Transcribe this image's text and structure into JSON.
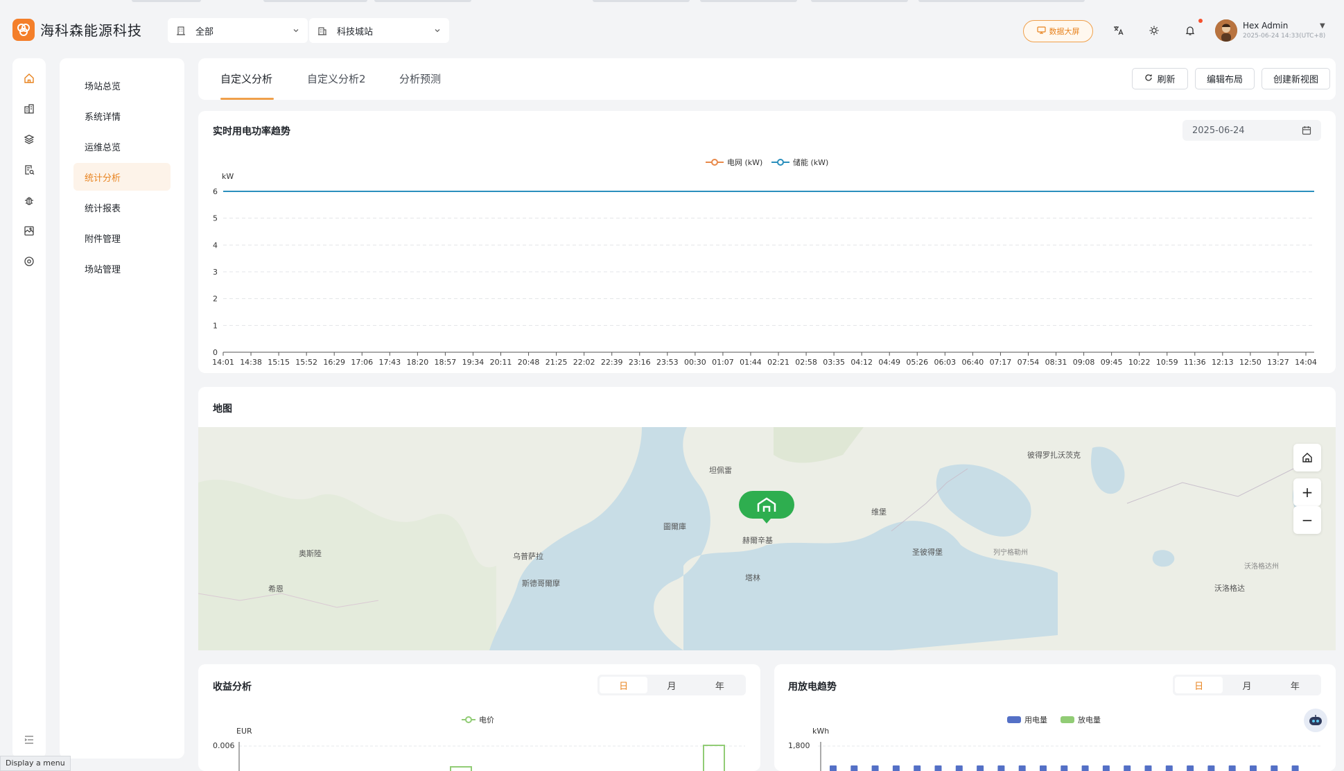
{
  "brand": {
    "name": "海科森能源科技"
  },
  "header": {
    "area_select": "全部",
    "station_select": "科技城站",
    "bigscreen_label": "数据大屏",
    "user": {
      "name": "Hex Admin",
      "datetime": "2025-06-24 14:33(UTC+8)"
    }
  },
  "subnav": {
    "items": [
      "场站总览",
      "系统详情",
      "运维总览",
      "统计分析",
      "统计报表",
      "附件管理",
      "场站管理"
    ],
    "active_index": 3
  },
  "tabs": {
    "items": [
      "自定义分析",
      "自定义分析2",
      "分析预测"
    ],
    "active_index": 0
  },
  "actions": {
    "refresh": "刷新",
    "edit_layout": "编辑布局",
    "create_view": "创建新视图"
  },
  "power_card": {
    "title": "实时用电功率趋势",
    "date": "2025-06-24"
  },
  "map_card": {
    "title": "地图",
    "labels": [
      "彼得罗扎沃茨克",
      "坦佩雷",
      "维堡",
      "圖爾庫",
      "赫爾辛基",
      "奥斯陸",
      "乌普萨拉",
      "圣彼得堡",
      "列宁格勒州",
      "沃洛格达州",
      "斯德哥爾摩",
      "塔林",
      "希恩",
      "沃洛格达"
    ]
  },
  "revenue_card": {
    "title": "收益分析",
    "periods": [
      "日",
      "月",
      "年"
    ],
    "active_period": 0
  },
  "energy_card": {
    "title": "用放电趋势",
    "periods": [
      "日",
      "月",
      "年"
    ],
    "active_period": 0
  },
  "tooltip": "Display a menu",
  "colors": {
    "accent": "#f0a04b",
    "grid_series": "#e8894a",
    "storage_series": "#2a8fbd",
    "charge": "#5470c6",
    "discharge": "#91cc75"
  },
  "chart_data": [
    {
      "type": "line",
      "ylabel": "kW",
      "ylim": [
        0,
        6
      ],
      "yticks": [
        0,
        1,
        2,
        3,
        4,
        5,
        6
      ],
      "x": [
        "14:01",
        "14:38",
        "15:15",
        "15:52",
        "16:29",
        "17:06",
        "17:43",
        "18:20",
        "18:57",
        "19:34",
        "20:11",
        "20:48",
        "21:25",
        "22:02",
        "22:39",
        "23:16",
        "23:53",
        "00:30",
        "01:07",
        "01:44",
        "02:21",
        "02:58",
        "03:35",
        "04:12",
        "04:49",
        "05:26",
        "06:03",
        "06:40",
        "07:17",
        "07:54",
        "08:31",
        "09:08",
        "09:45",
        "10:22",
        "10:59",
        "11:36",
        "12:13",
        "12:50",
        "13:27",
        "14:04"
      ],
      "series": [
        {
          "name": "电网 (kW)",
          "values": []
        },
        {
          "name": "储能 (kW)",
          "values": [
            6,
            6,
            6,
            6,
            6,
            6,
            6,
            6,
            6,
            6,
            6,
            6,
            6,
            6,
            6,
            6,
            6,
            6,
            6,
            6,
            6,
            6,
            6,
            6,
            6,
            6,
            6,
            6,
            6,
            6,
            6,
            6,
            6,
            6,
            6,
            6,
            6,
            6,
            6,
            6
          ]
        }
      ],
      "legend": "top-center"
    },
    {
      "type": "bar",
      "ylabel": "EUR",
      "yticks": [
        "0.006"
      ],
      "series": [
        {
          "name": "电价",
          "values": []
        }
      ],
      "legend": "top-center"
    },
    {
      "type": "bar",
      "ylabel": "kWh",
      "yticks": [
        "1,800"
      ],
      "series": [
        {
          "name": "用电量",
          "values": []
        },
        {
          "name": "放电量",
          "values": []
        }
      ],
      "legend": "top-center"
    }
  ]
}
